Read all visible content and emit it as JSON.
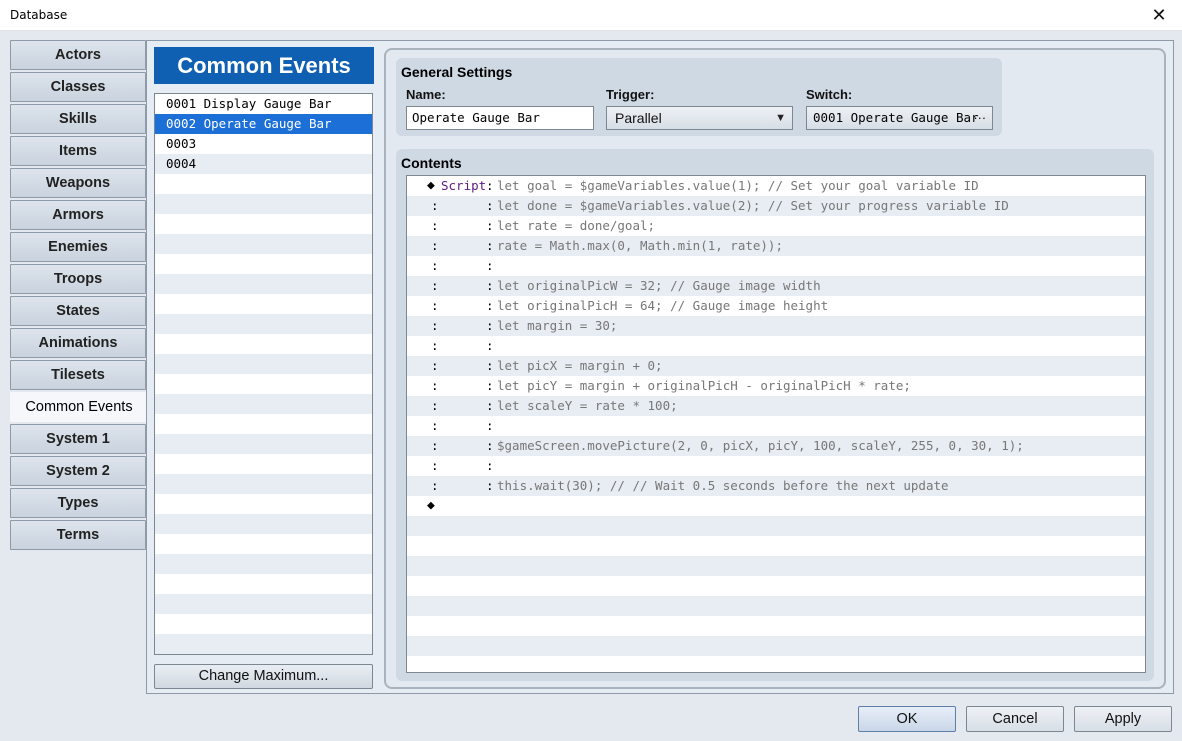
{
  "window": {
    "title": "Database",
    "close_glyph": "✕"
  },
  "tabs": [
    {
      "label": "Actors"
    },
    {
      "label": "Classes"
    },
    {
      "label": "Skills"
    },
    {
      "label": "Items"
    },
    {
      "label": "Weapons"
    },
    {
      "label": "Armors"
    },
    {
      "label": "Enemies"
    },
    {
      "label": "Troops"
    },
    {
      "label": "States"
    },
    {
      "label": "Animations"
    },
    {
      "label": "Tilesets"
    },
    {
      "label": "Common Events",
      "active": true
    },
    {
      "label": "System 1"
    },
    {
      "label": "System 2"
    },
    {
      "label": "Types"
    },
    {
      "label": "Terms"
    }
  ],
  "common_events": {
    "header": "Common Events",
    "items": [
      {
        "text": "0001 Display Gauge Bar"
      },
      {
        "text": "0002 Operate Gauge Bar",
        "selected": true
      },
      {
        "text": "0003"
      },
      {
        "text": "0004"
      }
    ],
    "change_max_label": "Change Maximum..."
  },
  "general_settings": {
    "heading": "General Settings",
    "name_label": "Name:",
    "name_value": "Operate Gauge Bar",
    "trigger_label": "Trigger:",
    "trigger_value": "Parallel",
    "trigger_arrow": "▼",
    "switch_label": "Switch:",
    "switch_value": "0001 Operate Gauge Bar",
    "switch_more": "···"
  },
  "contents": {
    "heading": "Contents",
    "lines": [
      {
        "marker": "◆",
        "command": "Script",
        "colon": ":",
        "text": "let goal = $gameVariables.value(1); // Set your goal variable ID"
      },
      {
        "cont": ":",
        "colon": ":",
        "text": "let done = $gameVariables.value(2); // Set your progress variable ID"
      },
      {
        "cont": ":",
        "colon": ":",
        "text": "let rate = done/goal;"
      },
      {
        "cont": ":",
        "colon": ":",
        "text": "rate = Math.max(0, Math.min(1, rate));"
      },
      {
        "cont": ":",
        "colon": ":",
        "text": ""
      },
      {
        "cont": ":",
        "colon": ":",
        "text": "let originalPicW = 32; // Gauge image width"
      },
      {
        "cont": ":",
        "colon": ":",
        "text": "let originalPicH = 64; // Gauge image height"
      },
      {
        "cont": ":",
        "colon": ":",
        "text": "let margin = 30;"
      },
      {
        "cont": ":",
        "colon": ":",
        "text": ""
      },
      {
        "cont": ":",
        "colon": ":",
        "text": "let picX = margin + 0;"
      },
      {
        "cont": ":",
        "colon": ":",
        "text": "let picY = margin + originalPicH - originalPicH * rate;"
      },
      {
        "cont": ":",
        "colon": ":",
        "text": "let scaleY = rate * 100;"
      },
      {
        "cont": ":",
        "colon": ":",
        "text": ""
      },
      {
        "cont": ":",
        "colon": ":",
        "text": "$gameScreen.movePicture(2, 0, picX, picY, 100, scaleY, 255, 0, 30, 1);"
      },
      {
        "cont": ":",
        "colon": ":",
        "text": ""
      },
      {
        "cont": ":",
        "colon": ":",
        "text": "this.wait(30); // // Wait 0.5 seconds before the next update"
      },
      {
        "marker": "◆"
      }
    ]
  },
  "buttons": {
    "ok": "OK",
    "cancel": "Cancel",
    "apply": "Apply"
  }
}
